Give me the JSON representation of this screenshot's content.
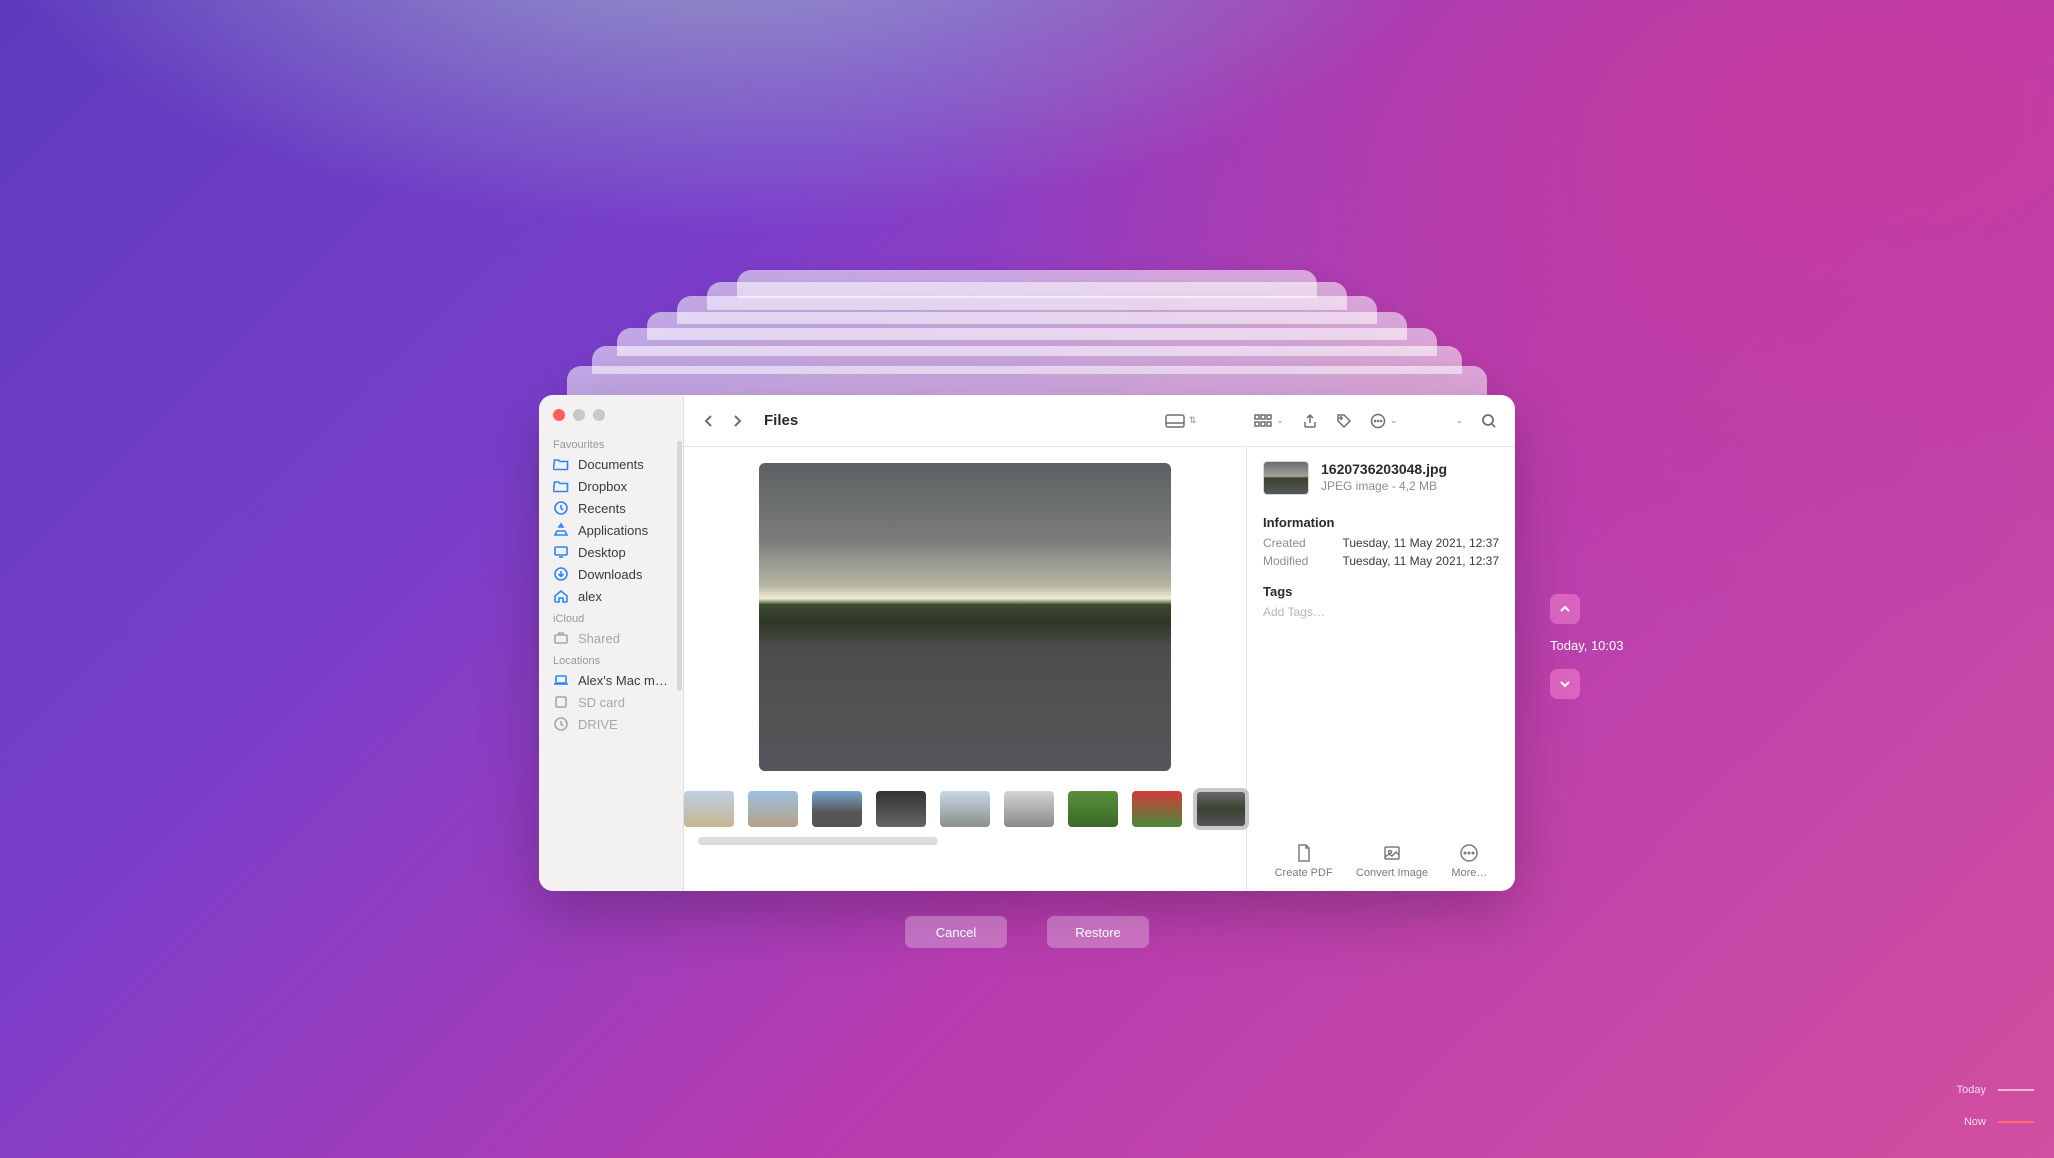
{
  "window": {
    "title": "Files"
  },
  "sidebar": {
    "sections": [
      {
        "label": "Favourites",
        "items": [
          {
            "icon": "folder",
            "label": "Documents"
          },
          {
            "icon": "folder",
            "label": "Dropbox"
          },
          {
            "icon": "clock",
            "label": "Recents"
          },
          {
            "icon": "apps",
            "label": "Applications"
          },
          {
            "icon": "desktop",
            "label": "Desktop"
          },
          {
            "icon": "download",
            "label": "Downloads"
          },
          {
            "icon": "home",
            "label": "alex"
          }
        ]
      },
      {
        "label": "iCloud",
        "items": [
          {
            "icon": "shared",
            "label": "Shared",
            "dim": true
          }
        ]
      },
      {
        "label": "Locations",
        "items": [
          {
            "icon": "laptop",
            "label": "Alex's Mac m…"
          },
          {
            "icon": "disk",
            "label": "SD card",
            "dim": true
          },
          {
            "icon": "clock",
            "label": "DRIVE",
            "dim": true
          }
        ]
      }
    ]
  },
  "file": {
    "name": "1620736203048.jpg",
    "subtitle": "JPEG image - 4,2 MB",
    "info_heading": "Information",
    "created_label": "Created",
    "created_value": "Tuesday, 11 May 2021, 12:37",
    "modified_label": "Modified",
    "modified_value": "Tuesday, 11 May 2021, 12:37",
    "tags_heading": "Tags",
    "tags_placeholder": "Add Tags…"
  },
  "actions": {
    "create_pdf": "Create PDF",
    "convert_image": "Convert Image",
    "more": "More…"
  },
  "buttons": {
    "cancel": "Cancel",
    "restore": "Restore"
  },
  "timeline": {
    "current": "Today, 10:03",
    "marks": [
      {
        "label": "Today"
      },
      {
        "label": "Now"
      }
    ]
  }
}
